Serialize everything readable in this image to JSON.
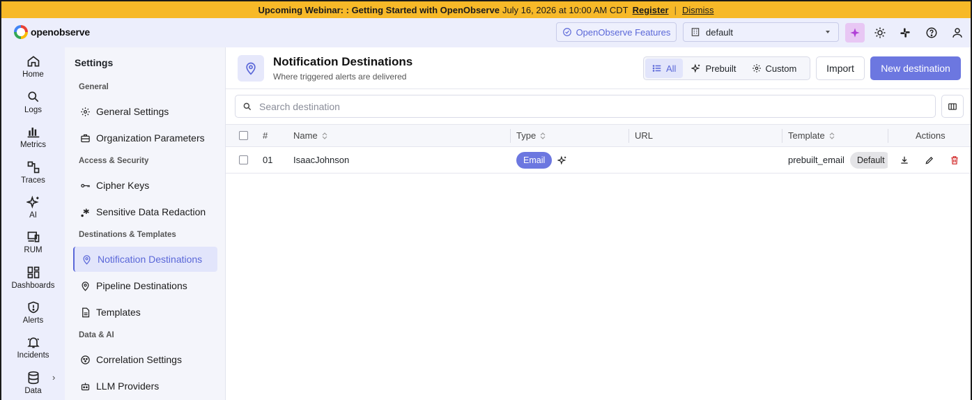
{
  "banner": {
    "title": "Upcoming Webinar: : Getting Started with OpenObserve",
    "date": "July 16, 2026 at 10:00 AM CDT",
    "register": "Register",
    "separator": "|",
    "dismiss": "Dismiss"
  },
  "header": {
    "logo_text": "openobserve",
    "features_label": "OpenObserve Features",
    "org_value": "default"
  },
  "leftnav": {
    "items": [
      {
        "label": "Home",
        "icon": "home-icon"
      },
      {
        "label": "Logs",
        "icon": "search-icon"
      },
      {
        "label": "Metrics",
        "icon": "bar-chart-icon"
      },
      {
        "label": "Traces",
        "icon": "traces-icon"
      },
      {
        "label": "AI",
        "icon": "sparkles-icon"
      },
      {
        "label": "RUM",
        "icon": "devices-icon"
      },
      {
        "label": "Dashboards",
        "icon": "dashboard-grid-icon"
      },
      {
        "label": "Alerts",
        "icon": "shield-alert-icon"
      },
      {
        "label": "Incidents",
        "icon": "bell-icon"
      },
      {
        "label": "Data",
        "icon": "database-icon"
      }
    ],
    "data_chevron": "›"
  },
  "settings": {
    "title": "Settings",
    "sections": {
      "general": "General",
      "access": "Access & Security",
      "destinations": "Destinations & Templates",
      "data_ai": "Data & AI"
    },
    "items": {
      "general_settings": "General Settings",
      "org_params": "Organization Parameters",
      "cipher_keys": "Cipher Keys",
      "redaction": "Sensitive Data Redaction",
      "notification_destinations": "Notification Destinations",
      "pipeline_destinations": "Pipeline Destinations",
      "templates": "Templates",
      "correlation": "Correlation Settings",
      "llm": "LLM Providers"
    }
  },
  "main": {
    "title": "Notification Destinations",
    "subtitle": "Where triggered alerts are delivered",
    "filters": {
      "all": "All",
      "prebuilt": "Prebuilt",
      "custom": "Custom"
    },
    "import_label": "Import",
    "new_label": "New destination",
    "search_placeholder": "Search destination",
    "columns": {
      "num": "#",
      "name": "Name",
      "type": "Type",
      "url": "URL",
      "template": "Template",
      "actions": "Actions"
    },
    "rows": [
      {
        "num": "01",
        "name": "IsaacJohnson",
        "type": "Email",
        "url": "",
        "template": "prebuilt_email",
        "template_badge": "Default"
      }
    ]
  },
  "colors": {
    "accent": "#6c77e0",
    "banner": "#f7b928",
    "nav_bg": "#eceefc",
    "delete": "#d32f2f"
  }
}
